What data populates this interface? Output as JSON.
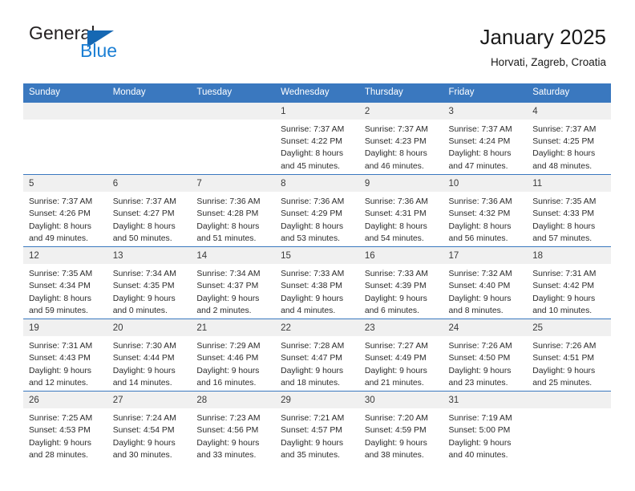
{
  "brand": {
    "name_top": "General",
    "name_bottom": "Blue",
    "triangle_icon": "blue-triangle-logo-mark",
    "color_dark": "#231f20",
    "color_blue": "#1b7fd4"
  },
  "header": {
    "title": "January 2025",
    "subtitle": "Horvati, Zagreb, Croatia"
  },
  "theme": {
    "header_blue": "#3a78bf",
    "daynum_band": "#f0f0f0",
    "text": "#2b2b2b"
  },
  "weekdays": [
    "Sunday",
    "Monday",
    "Tuesday",
    "Wednesday",
    "Thursday",
    "Friday",
    "Saturday"
  ],
  "labels": {
    "sunrise": "Sunrise:",
    "sunset": "Sunset:",
    "daylight": "Daylight:"
  },
  "weeks": [
    [
      {
        "day": "",
        "blank": true
      },
      {
        "day": "",
        "blank": true
      },
      {
        "day": "",
        "blank": true
      },
      {
        "day": "1",
        "sunrise": "Sunrise: 7:37 AM",
        "sunset": "Sunset: 4:22 PM",
        "daylight1": "Daylight: 8 hours",
        "daylight2": "and 45 minutes."
      },
      {
        "day": "2",
        "sunrise": "Sunrise: 7:37 AM",
        "sunset": "Sunset: 4:23 PM",
        "daylight1": "Daylight: 8 hours",
        "daylight2": "and 46 minutes."
      },
      {
        "day": "3",
        "sunrise": "Sunrise: 7:37 AM",
        "sunset": "Sunset: 4:24 PM",
        "daylight1": "Daylight: 8 hours",
        "daylight2": "and 47 minutes."
      },
      {
        "day": "4",
        "sunrise": "Sunrise: 7:37 AM",
        "sunset": "Sunset: 4:25 PM",
        "daylight1": "Daylight: 8 hours",
        "daylight2": "and 48 minutes."
      }
    ],
    [
      {
        "day": "5",
        "sunrise": "Sunrise: 7:37 AM",
        "sunset": "Sunset: 4:26 PM",
        "daylight1": "Daylight: 8 hours",
        "daylight2": "and 49 minutes."
      },
      {
        "day": "6",
        "sunrise": "Sunrise: 7:37 AM",
        "sunset": "Sunset: 4:27 PM",
        "daylight1": "Daylight: 8 hours",
        "daylight2": "and 50 minutes."
      },
      {
        "day": "7",
        "sunrise": "Sunrise: 7:36 AM",
        "sunset": "Sunset: 4:28 PM",
        "daylight1": "Daylight: 8 hours",
        "daylight2": "and 51 minutes."
      },
      {
        "day": "8",
        "sunrise": "Sunrise: 7:36 AM",
        "sunset": "Sunset: 4:29 PM",
        "daylight1": "Daylight: 8 hours",
        "daylight2": "and 53 minutes."
      },
      {
        "day": "9",
        "sunrise": "Sunrise: 7:36 AM",
        "sunset": "Sunset: 4:31 PM",
        "daylight1": "Daylight: 8 hours",
        "daylight2": "and 54 minutes."
      },
      {
        "day": "10",
        "sunrise": "Sunrise: 7:36 AM",
        "sunset": "Sunset: 4:32 PM",
        "daylight1": "Daylight: 8 hours",
        "daylight2": "and 56 minutes."
      },
      {
        "day": "11",
        "sunrise": "Sunrise: 7:35 AM",
        "sunset": "Sunset: 4:33 PM",
        "daylight1": "Daylight: 8 hours",
        "daylight2": "and 57 minutes."
      }
    ],
    [
      {
        "day": "12",
        "sunrise": "Sunrise: 7:35 AM",
        "sunset": "Sunset: 4:34 PM",
        "daylight1": "Daylight: 8 hours",
        "daylight2": "and 59 minutes."
      },
      {
        "day": "13",
        "sunrise": "Sunrise: 7:34 AM",
        "sunset": "Sunset: 4:35 PM",
        "daylight1": "Daylight: 9 hours",
        "daylight2": "and 0 minutes."
      },
      {
        "day": "14",
        "sunrise": "Sunrise: 7:34 AM",
        "sunset": "Sunset: 4:37 PM",
        "daylight1": "Daylight: 9 hours",
        "daylight2": "and 2 minutes."
      },
      {
        "day": "15",
        "sunrise": "Sunrise: 7:33 AM",
        "sunset": "Sunset: 4:38 PM",
        "daylight1": "Daylight: 9 hours",
        "daylight2": "and 4 minutes."
      },
      {
        "day": "16",
        "sunrise": "Sunrise: 7:33 AM",
        "sunset": "Sunset: 4:39 PM",
        "daylight1": "Daylight: 9 hours",
        "daylight2": "and 6 minutes."
      },
      {
        "day": "17",
        "sunrise": "Sunrise: 7:32 AM",
        "sunset": "Sunset: 4:40 PM",
        "daylight1": "Daylight: 9 hours",
        "daylight2": "and 8 minutes."
      },
      {
        "day": "18",
        "sunrise": "Sunrise: 7:31 AM",
        "sunset": "Sunset: 4:42 PM",
        "daylight1": "Daylight: 9 hours",
        "daylight2": "and 10 minutes."
      }
    ],
    [
      {
        "day": "19",
        "sunrise": "Sunrise: 7:31 AM",
        "sunset": "Sunset: 4:43 PM",
        "daylight1": "Daylight: 9 hours",
        "daylight2": "and 12 minutes."
      },
      {
        "day": "20",
        "sunrise": "Sunrise: 7:30 AM",
        "sunset": "Sunset: 4:44 PM",
        "daylight1": "Daylight: 9 hours",
        "daylight2": "and 14 minutes."
      },
      {
        "day": "21",
        "sunrise": "Sunrise: 7:29 AM",
        "sunset": "Sunset: 4:46 PM",
        "daylight1": "Daylight: 9 hours",
        "daylight2": "and 16 minutes."
      },
      {
        "day": "22",
        "sunrise": "Sunrise: 7:28 AM",
        "sunset": "Sunset: 4:47 PM",
        "daylight1": "Daylight: 9 hours",
        "daylight2": "and 18 minutes."
      },
      {
        "day": "23",
        "sunrise": "Sunrise: 7:27 AM",
        "sunset": "Sunset: 4:49 PM",
        "daylight1": "Daylight: 9 hours",
        "daylight2": "and 21 minutes."
      },
      {
        "day": "24",
        "sunrise": "Sunrise: 7:26 AM",
        "sunset": "Sunset: 4:50 PM",
        "daylight1": "Daylight: 9 hours",
        "daylight2": "and 23 minutes."
      },
      {
        "day": "25",
        "sunrise": "Sunrise: 7:26 AM",
        "sunset": "Sunset: 4:51 PM",
        "daylight1": "Daylight: 9 hours",
        "daylight2": "and 25 minutes."
      }
    ],
    [
      {
        "day": "26",
        "sunrise": "Sunrise: 7:25 AM",
        "sunset": "Sunset: 4:53 PM",
        "daylight1": "Daylight: 9 hours",
        "daylight2": "and 28 minutes."
      },
      {
        "day": "27",
        "sunrise": "Sunrise: 7:24 AM",
        "sunset": "Sunset: 4:54 PM",
        "daylight1": "Daylight: 9 hours",
        "daylight2": "and 30 minutes."
      },
      {
        "day": "28",
        "sunrise": "Sunrise: 7:23 AM",
        "sunset": "Sunset: 4:56 PM",
        "daylight1": "Daylight: 9 hours",
        "daylight2": "and 33 minutes."
      },
      {
        "day": "29",
        "sunrise": "Sunrise: 7:21 AM",
        "sunset": "Sunset: 4:57 PM",
        "daylight1": "Daylight: 9 hours",
        "daylight2": "and 35 minutes."
      },
      {
        "day": "30",
        "sunrise": "Sunrise: 7:20 AM",
        "sunset": "Sunset: 4:59 PM",
        "daylight1": "Daylight: 9 hours",
        "daylight2": "and 38 minutes."
      },
      {
        "day": "31",
        "sunrise": "Sunrise: 7:19 AM",
        "sunset": "Sunset: 5:00 PM",
        "daylight1": "Daylight: 9 hours",
        "daylight2": "and 40 minutes."
      },
      {
        "day": "",
        "blank": true
      }
    ]
  ]
}
